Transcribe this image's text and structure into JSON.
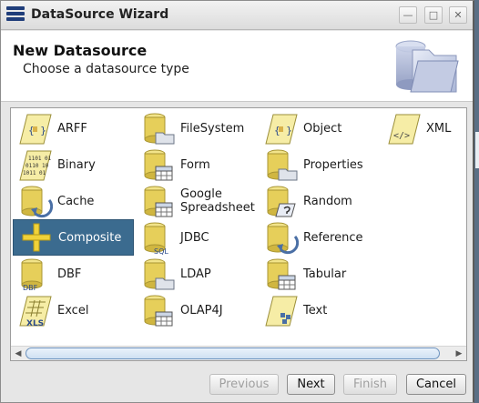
{
  "window": {
    "title": "DataSource Wizard",
    "minimize_symbol": "—",
    "maximize_symbol": "□",
    "close_symbol": "✕"
  },
  "header": {
    "title": "New Datasource",
    "subtitle": "Choose a datasource type"
  },
  "datasources": {
    "arff": "ARFF",
    "filesystem": "FileSystem",
    "object": "Object",
    "xml": "XML",
    "binary": "Binary",
    "form": "Form",
    "properties": "Properties",
    "cache": "Cache",
    "google_spreadsheet_line1": "Google",
    "google_spreadsheet_line2": "Spreadsheet",
    "random": "Random",
    "composite": "Composite",
    "jdbc": "JDBC",
    "reference": "Reference",
    "dbf": "DBF",
    "ldap": "LDAP",
    "tabular": "Tabular",
    "excel": "Excel",
    "olap4j": "OLAP4J",
    "text": "Text",
    "selected": "Composite"
  },
  "icon_text": {
    "arff_braces": "{ }",
    "object_braces": "{ }",
    "xml_tag": "</>",
    "binary_row1": "1101 01",
    "binary_row2": "0110 10",
    "binary_row3": "1011 01",
    "sql": "SQL",
    "dbf": "DBF",
    "xls": "XLS"
  },
  "buttons": {
    "previous": "Previous",
    "next": "Next",
    "finish": "Finish",
    "cancel": "Cancel"
  },
  "colors": {
    "selection": "#3b6b8f",
    "titlebar_icon": "#1f3d7a",
    "scroll_thumb_border": "#6d93bf"
  }
}
